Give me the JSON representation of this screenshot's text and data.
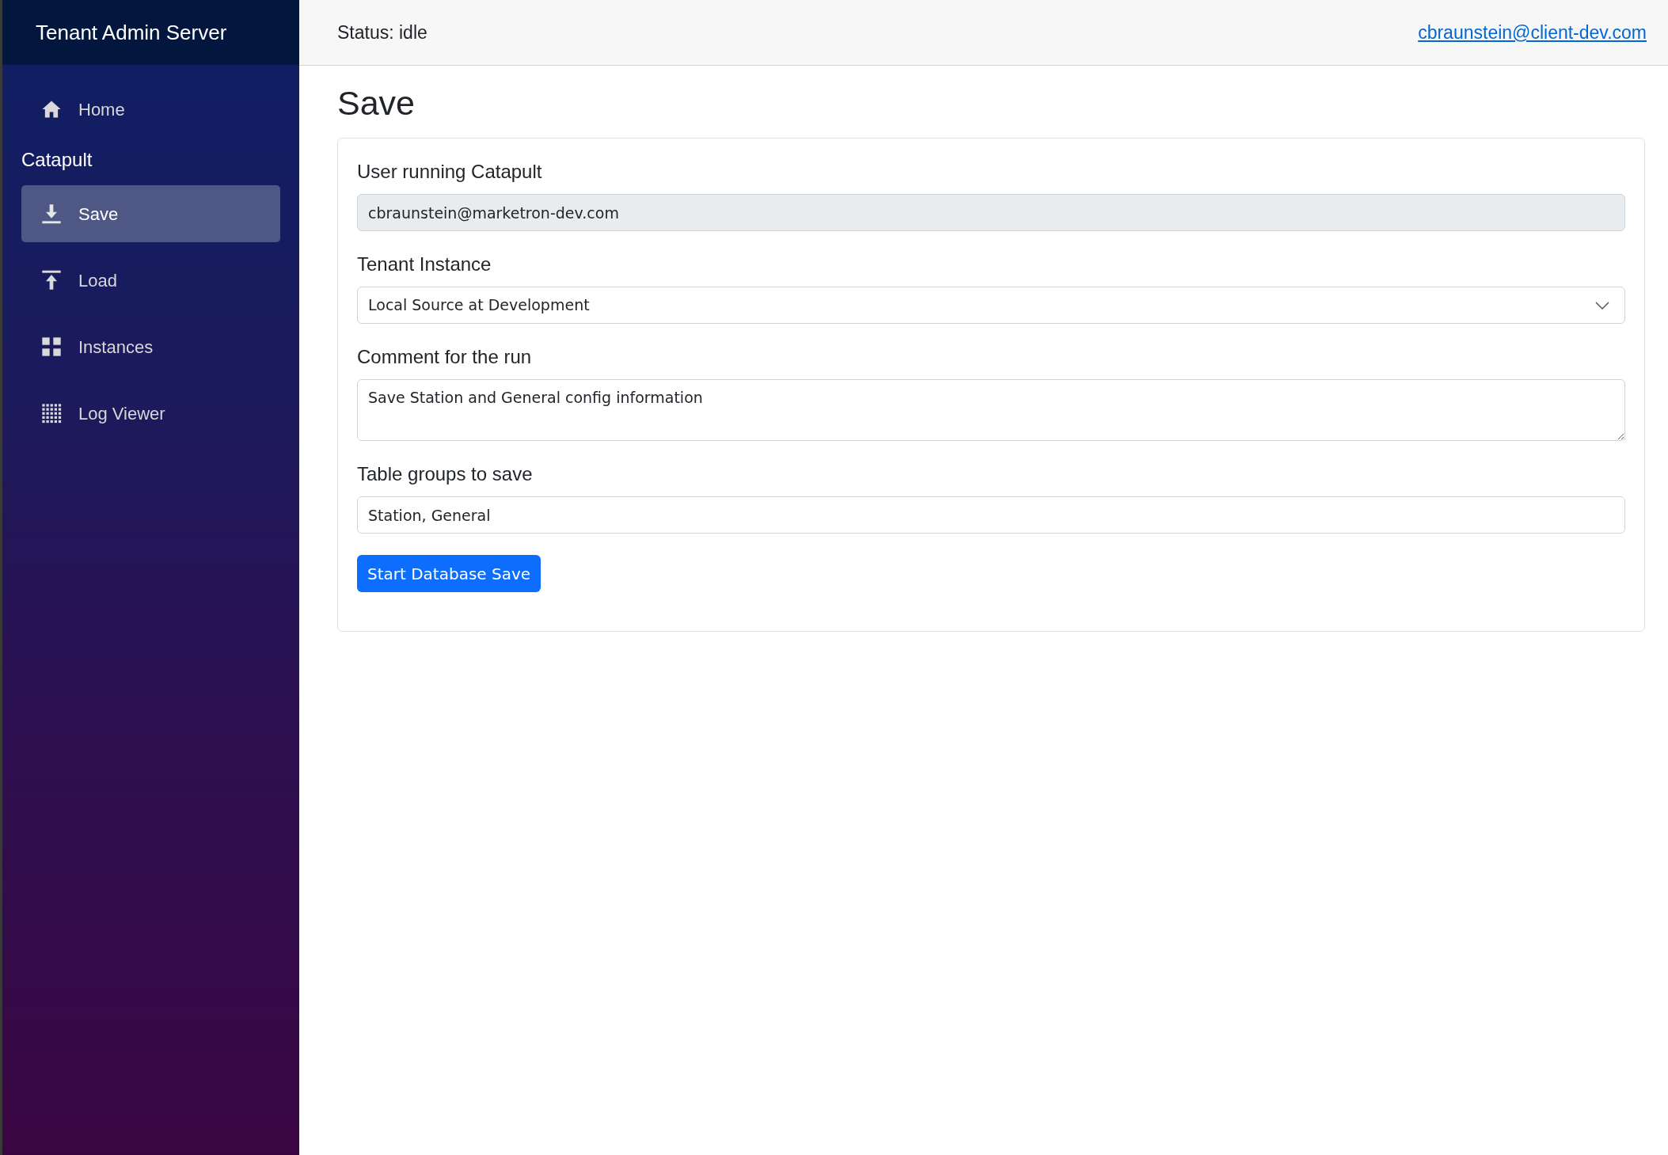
{
  "sidebar": {
    "title": "Tenant Admin Server",
    "items": [
      {
        "kind": "link",
        "label": "Home",
        "selected": false
      },
      {
        "kind": "heading",
        "label": "Catapult"
      },
      {
        "kind": "link",
        "label": "Save",
        "selected": true
      },
      {
        "kind": "link",
        "label": "Load",
        "selected": false
      },
      {
        "kind": "link",
        "label": "Instances",
        "selected": false
      },
      {
        "kind": "link",
        "label": "Log Viewer",
        "selected": false
      }
    ]
  },
  "top_bar": {
    "status": "Status: idle",
    "user_link": "cbraunstein@client-dev.com"
  },
  "page_title": "Save",
  "form": {
    "fields": [
      {
        "kind": "readonly",
        "label": "User running Catapult",
        "value": "cbraunstein@marketron-dev.com"
      },
      {
        "kind": "select",
        "label": "Tenant Instance",
        "value": "Local Source at Development"
      },
      {
        "kind": "textarea",
        "label": "Comment for the run",
        "value": "Save Station and General config information"
      },
      {
        "kind": "text",
        "label": "Table groups to save",
        "value": "Station, General"
      }
    ],
    "submit": "Start Database Save"
  }
}
